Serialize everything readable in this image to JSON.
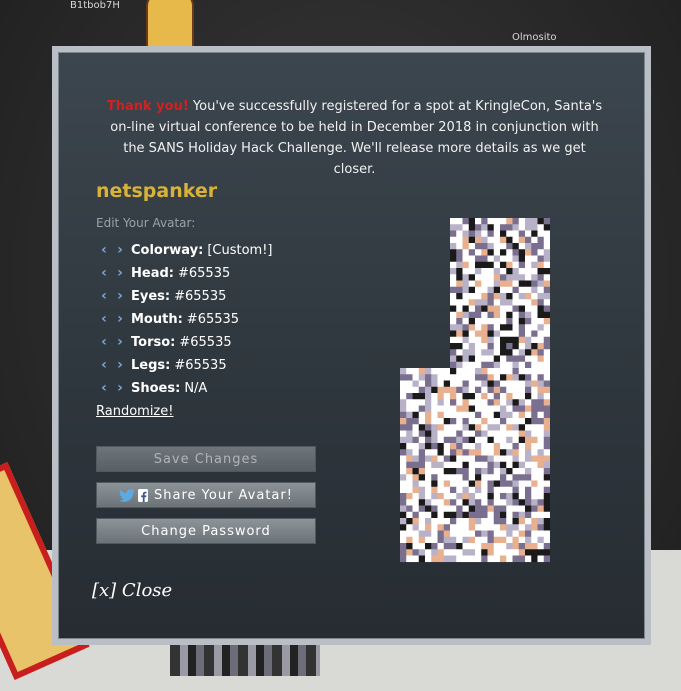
{
  "background": {
    "player_names": [
      "B1tbob7H",
      "Olmosito"
    ]
  },
  "modal": {
    "thanks": "Thank you!",
    "message": "You've successfully registered for a spot at KringleCon, Santa's on-line virtual conference to be held in December 2018 in conjunction with the SANS Holiday Hack Challenge. We'll release more details as we get closer.",
    "username": "netspanker",
    "edit_label": "Edit Your Avatar:",
    "attributes": [
      {
        "label": "Colorway:",
        "value": "[Custom!]"
      },
      {
        "label": "Head:",
        "value": "#65535"
      },
      {
        "label": "Eyes:",
        "value": "#65535"
      },
      {
        "label": "Mouth:",
        "value": "#65535"
      },
      {
        "label": "Torso:",
        "value": "#65535"
      },
      {
        "label": "Legs:",
        "value": "#65535"
      },
      {
        "label": "Shoes:",
        "value": "N/A"
      }
    ],
    "randomize": "Randomize!",
    "buttons": {
      "save": "Save Changes",
      "share": "Share Your Avatar!",
      "change_password": "Change Password"
    },
    "close": "[x] Close"
  },
  "colors": {
    "accent_red": "#d42020",
    "username_gold": "#d8b23a",
    "arrow_blue": "#7ea6d8",
    "avatar_palette": [
      "#ffffff",
      "#7a6f8e",
      "#e8b08e",
      "#1a1a1a",
      "#b8b2c8"
    ]
  },
  "icons": [
    "chevron-left-icon",
    "chevron-right-icon",
    "twitter-icon",
    "facebook-icon"
  ]
}
